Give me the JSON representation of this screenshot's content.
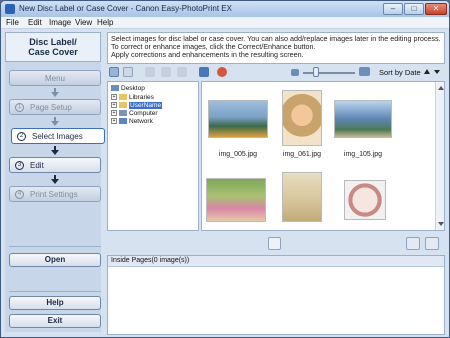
{
  "window": {
    "title": "New Disc Label or Case Cover - Canon Easy-PhotoPrint EX"
  },
  "menu": [
    "File",
    "Edit",
    "Image",
    "View",
    "Help"
  ],
  "left_panel": {
    "heading_line1": "Disc Label/",
    "heading_line2": "Case Cover",
    "steps": [
      {
        "label": "Menu",
        "state": "disabled"
      },
      {
        "num": "1",
        "label": "Page Setup",
        "state": "disabled"
      },
      {
        "num": "2",
        "label": "Select Images",
        "state": "active"
      },
      {
        "num": "3",
        "label": "Edit",
        "state": "enabled"
      },
      {
        "num": "4",
        "label": "Print Settings",
        "state": "disabled"
      }
    ],
    "open_label": "Open",
    "help_label": "Help",
    "exit_label": "Exit"
  },
  "instructions": {
    "line1": "Select images for disc label or case cover. You can also add/replace images later in the editing process.",
    "line2": "To correct or enhance images, click the Correct/Enhance button.",
    "line3": "Apply corrections and enhancements in the resulting screen."
  },
  "toolbar": {
    "sort_label": "Sort by Date"
  },
  "folder_tree": [
    {
      "label": "Desktop",
      "level": 0,
      "expander": ""
    },
    {
      "label": "Libraries",
      "level": 1,
      "expander": "+"
    },
    {
      "label": "UserName",
      "level": 1,
      "expander": "+",
      "selected": true
    },
    {
      "label": "Computer",
      "level": 1,
      "expander": "+"
    },
    {
      "label": "Network",
      "level": 1,
      "expander": "+"
    }
  ],
  "thumbnails": [
    {
      "filename": "img_005.jpg",
      "color": "#6f8fb0"
    },
    {
      "filename": "img_061.jpg",
      "color": "#c9a36c"
    },
    {
      "filename": "img_105.jpg",
      "color": "#5f86b3"
    },
    {
      "filename": "",
      "color": "#8fae6a"
    },
    {
      "filename": "",
      "color": "#d9c9a0"
    },
    {
      "filename": "",
      "color": "#c98a86"
    }
  ],
  "inside_pages": {
    "label": "Inside Pages(0 image(s))"
  }
}
